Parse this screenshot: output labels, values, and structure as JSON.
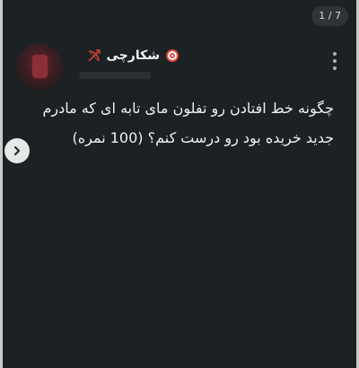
{
  "viewer": {
    "page_counter": "1 / 7"
  },
  "post": {
    "author": {
      "username": "شکارچی",
      "badge_icons": [
        "target-icon",
        "bow-arrow-icon"
      ]
    },
    "body_text": "چگونه خط افتادن رو تفلون مای تابه ای که مادرم جدید خریده بود رو درست کنم؟ (100 نمره)"
  },
  "controls": {
    "more_icon": "more-vertical-icon",
    "next_icon": "chevron-right-icon"
  },
  "colors": {
    "background": "#1c2123",
    "text": "#eef1f1",
    "target_red": "#e0463e",
    "bow_red": "#d8423c"
  }
}
